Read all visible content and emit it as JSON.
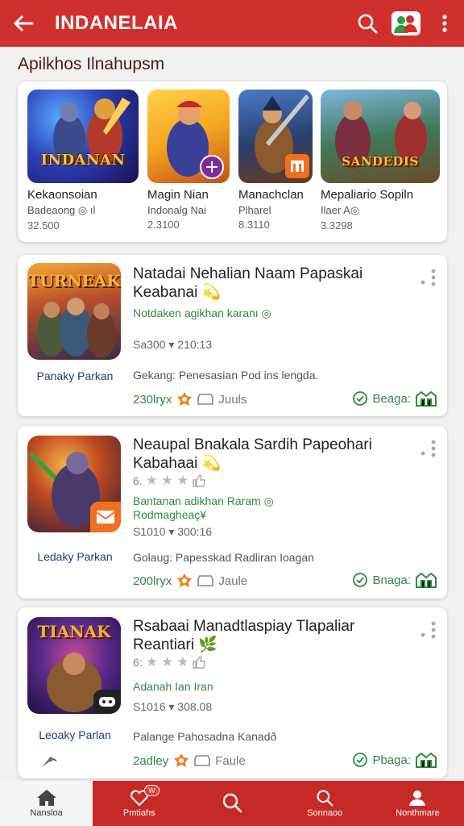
{
  "app": {
    "title": "INDANELAIA"
  },
  "section": {
    "title": "Apilkhos Ilnahupsm"
  },
  "featured": [
    {
      "name": "Kekaonsoian",
      "sub": "Badeaong ◎ ıl",
      "num": "32.500",
      "art": "INDANAN"
    },
    {
      "name": "Magin Nian",
      "sub": "Indonalg Nai",
      "num": "2.3100",
      "art": ""
    },
    {
      "name": "Manachclan",
      "sub": "Plharel",
      "num": "8.3110",
      "art": ""
    },
    {
      "name": "Mepaliario Sopiln",
      "sub": "Ilaer A◎",
      "num": "3.3298",
      "art": "SANDEDIS"
    }
  ],
  "cards": [
    {
      "title": "Natadai Nehalian Naam Papaskai Keabanai 💫",
      "art": "TURNEAK",
      "dev": "Panaky Parkan",
      "green": "Notdaken agikhan karanı ◎",
      "meta": "Sa300 ▾ 210:13",
      "desc": "Gekang: Penesasian Pod ins lengda.",
      "size": "230lryx",
      "reviews": "Juuls",
      "get": "Beaga:"
    },
    {
      "title": "Neaupal Bnakala Sardih Papeohari Kabahaai 💫",
      "art": "",
      "dev": "Ledaky Parkan",
      "rating": "6.",
      "green": "Bantanan adikhan Raram ◎ Rodmagheaç¥",
      "meta": "S1010 ▾ 300:16",
      "desc": "Golaug: Papesskad Radliran Ioagan",
      "size": "200lryx",
      "reviews": "Jaule",
      "get": "Bnaga:"
    },
    {
      "title": "Rsabaai Manadtlaspiay Tlapaliar Reantiari 🌿",
      "art": "TIANAK",
      "dev": "Leoaky Parlan",
      "rating": "6:",
      "green": "Adanah Ian Iran",
      "meta": "S1016 ▾ 308.08",
      "desc": "Palange Pahosadna Kanadð",
      "size": "2adley",
      "reviews": "Faule",
      "get": "Pbaga:"
    }
  ],
  "nav": [
    {
      "label": "Nansloa",
      "icon": "home-icon"
    },
    {
      "label": "Pmtiahs",
      "icon": "heart-icon",
      "count": "W"
    },
    {
      "label": "",
      "icon": "search-icon"
    },
    {
      "label": "Sonnaoo",
      "icon": "search-icon"
    },
    {
      "label": "Nonthmare",
      "icon": "person-icon"
    }
  ],
  "colors": {
    "primary": "#d0302c",
    "green": "#2e8b3e",
    "dev_blue": "#1b3f7a"
  }
}
